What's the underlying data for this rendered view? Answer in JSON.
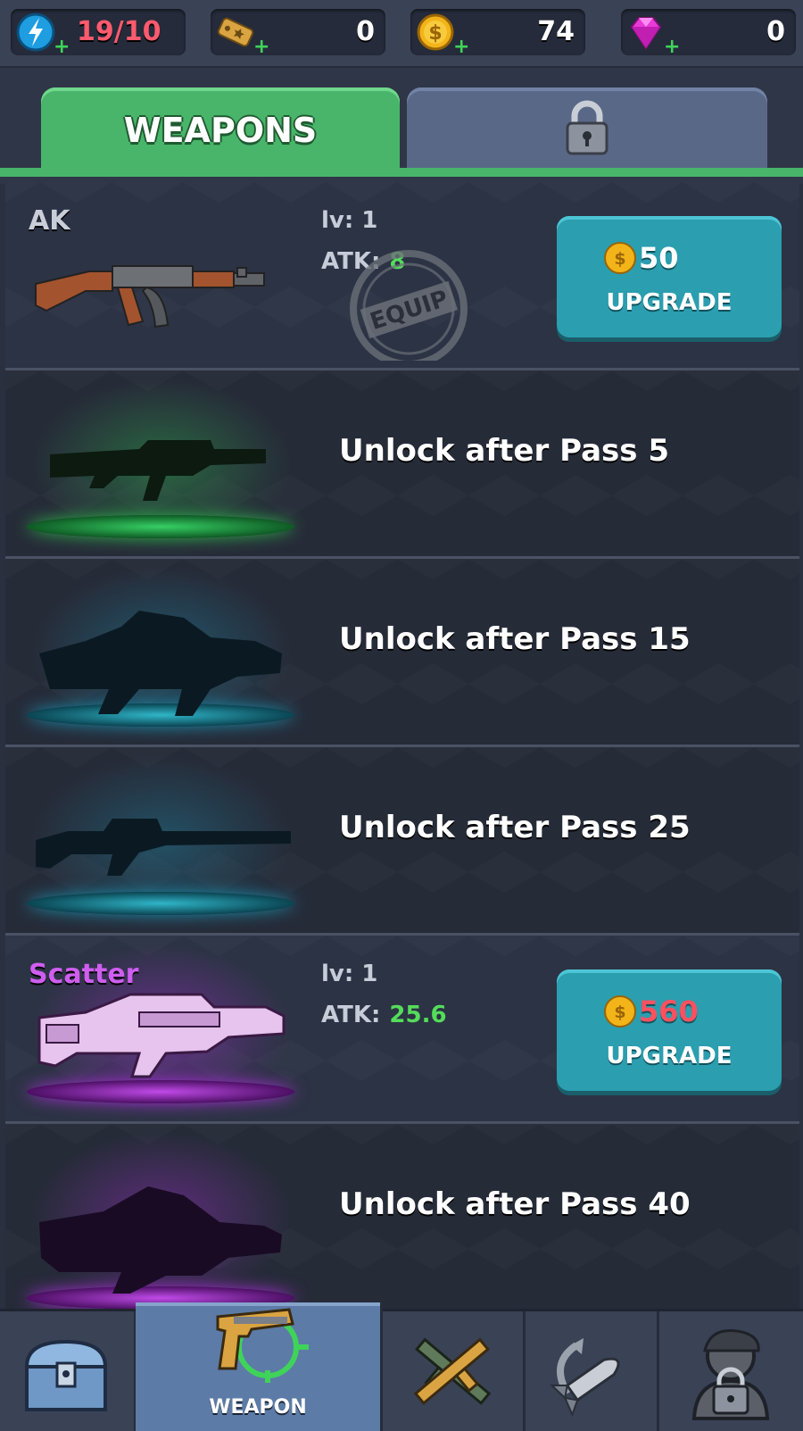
{
  "resources": {
    "energy": "19/10",
    "ticket": "0",
    "coins": "74",
    "gems": "0"
  },
  "tabs": {
    "weapons_label": "WEAPONS",
    "locked_tab_icon": "padlock-icon"
  },
  "weapons": [
    {
      "name": "AK",
      "level_label": "lv: 1",
      "atk_label": "ATK:",
      "atk_value": "8",
      "stamp": "EQUIP",
      "cost": "50",
      "button_label": "UPGRADE"
    },
    {
      "unlock_text": "Unlock after Pass 5",
      "glow_color": "#2fae4c"
    },
    {
      "unlock_text": "Unlock after Pass 15",
      "glow_color": "#1d8aa8"
    },
    {
      "unlock_text": "Unlock after Pass 25",
      "glow_color": "#1d8aa8"
    },
    {
      "name": "Scatter",
      "level_label": "lv: 1",
      "atk_label": "ATK:",
      "atk_value": "25.6",
      "cost": "560",
      "button_label": "UPGRADE"
    },
    {
      "unlock_text": "Unlock after Pass 40",
      "glow_color": "#a22fd0"
    }
  ],
  "bottom_nav": {
    "active_label": "WEAPON",
    "items": [
      "chest-icon",
      "pistol-icon",
      "crossed-guns-icon",
      "rocket-icon",
      "locked-character-icon"
    ]
  },
  "colors": {
    "tab_green": "#48b56a",
    "button_teal": "#2b9eaf",
    "atk_green": "#54dc5a",
    "energy_red": "#ff5a6e",
    "scatter_purple": "#cf5ef0"
  }
}
